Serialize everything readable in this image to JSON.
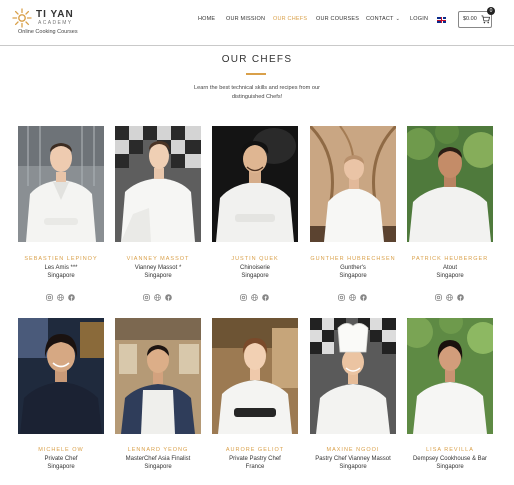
{
  "brand": {
    "title": "TI YAN",
    "subtitle": "ACADEMY",
    "tagline": "Online Cooking Courses"
  },
  "nav": {
    "items": [
      {
        "label": "HOME",
        "active": false
      },
      {
        "label": "OUR MISSION",
        "active": false
      },
      {
        "label": "OUR CHEFS",
        "active": true
      },
      {
        "label": "OUR COURSES",
        "active": false
      },
      {
        "label": "CONTACT",
        "active": false,
        "dropdown": true
      },
      {
        "label": "LOGIN",
        "active": false
      }
    ],
    "language_flag": "uk-flag-icon",
    "cart": {
      "total": "$0.00",
      "count": "0"
    }
  },
  "section": {
    "title": "OUR CHEFS",
    "intro": "Learn the best technical skills and recipes from our distinguished Chefs!"
  },
  "colors": {
    "accent": "#d9a04a",
    "text": "#333333"
  },
  "chefs": [
    {
      "name": "SEBASTIEN LEPINOY",
      "role": "Les Amis ***",
      "location": "Singapore",
      "socials": [
        "instagram-icon",
        "globe-icon",
        "facebook-icon"
      ]
    },
    {
      "name": "VIANNEY MASSOT",
      "role": "Vianney Massot *",
      "location": "Singapore",
      "socials": [
        "instagram-icon",
        "globe-icon",
        "facebook-icon"
      ]
    },
    {
      "name": "JUSTIN QUEK",
      "role": "Chinoiserie",
      "location": "Singapore",
      "socials": [
        "instagram-icon",
        "globe-icon",
        "facebook-icon"
      ]
    },
    {
      "name": "GUNTHER HUBRECHSEN",
      "role": "Gunther's",
      "location": "Singapore",
      "socials": [
        "instagram-icon",
        "globe-icon",
        "facebook-icon"
      ]
    },
    {
      "name": "PATRICK HEUBERGER",
      "role": "Atout",
      "location": "Singapore",
      "socials": [
        "instagram-icon",
        "globe-icon",
        "facebook-icon"
      ]
    },
    {
      "name": "MICHELE OW",
      "role": "Private Chef",
      "location": "Singapore"
    },
    {
      "name": "LENNARD YEONG",
      "role": "MasterChef Asia Finalist",
      "location": "Singapore"
    },
    {
      "name": "AURORE GELIOT",
      "role": "Private Pastry Chef",
      "location": "France"
    },
    {
      "name": "MAXINE NGOOI",
      "role": "Pastry Chef Vianney Massot",
      "location": "Singapore"
    },
    {
      "name": "LISA REVILLA",
      "role": "Dempsey Cookhouse & Bar",
      "location": "Singapore"
    }
  ]
}
